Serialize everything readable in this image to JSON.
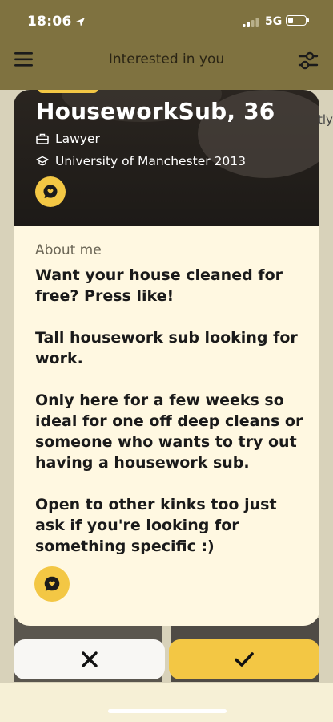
{
  "status_bar": {
    "time": "18:06",
    "network": "5G"
  },
  "navbar": {
    "title": "Interested in you",
    "menu_icon": "hamburger-menu-icon",
    "filter_icon": "filter-sliders-icon"
  },
  "background": {
    "peek_text": "tly"
  },
  "profile": {
    "name": "HouseworkSub, 36",
    "job": "Lawyer",
    "education": "University of Manchester 2013",
    "about_label": "About me",
    "bio": [
      "Want your house cleaned for free? Press like!",
      "Tall housework sub looking for work.",
      "Only here for a few weeks so ideal for one off deep cleans or someone who wants to try out having a housework sub.",
      "Open to other kinks too just ask if you're looking for something specific :)"
    ]
  },
  "actions": {
    "pass_icon": "x-icon",
    "like_icon": "checkmark-icon"
  },
  "colors": {
    "accent": "#f3c744",
    "card_bg": "#fff8e1",
    "header_bg": "#7f7240"
  }
}
